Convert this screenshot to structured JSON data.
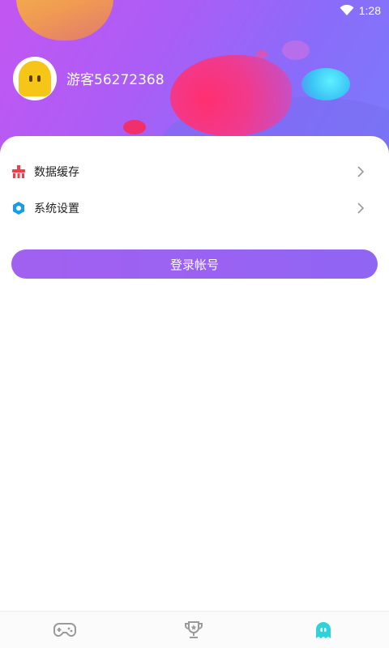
{
  "status_bar": {
    "time": "1:28",
    "wifi_icon": "wifi-icon"
  },
  "profile": {
    "username": "游客56272368",
    "avatar_icon": "ghost-avatar-icon"
  },
  "menu": {
    "items": [
      {
        "label": "数据缓存",
        "icon": "broom-icon",
        "icon_color": "#f0404a"
      },
      {
        "label": "系统设置",
        "icon": "hexagon-settings-icon",
        "icon_color": "#1a9be8"
      }
    ]
  },
  "login_button": {
    "label": "登录帐号"
  },
  "tabbar": {
    "tabs": [
      {
        "name": "games",
        "icon": "gamepad-icon",
        "active": false
      },
      {
        "name": "rank",
        "icon": "trophy-icon",
        "active": false
      },
      {
        "name": "me",
        "icon": "ghost-icon",
        "active": true
      }
    ],
    "active_color": "#2ed3d8",
    "inactive_color": "#9a9a9a"
  },
  "colors": {
    "accent": "#9b62f2"
  }
}
